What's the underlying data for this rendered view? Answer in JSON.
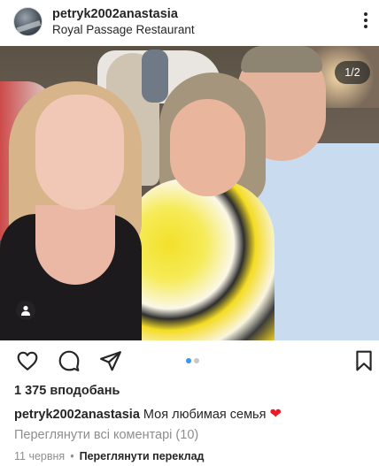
{
  "post": {
    "username": "petryk2002anastasia",
    "location": "Royal Passage Restaurant",
    "carousel_counter": "1/2",
    "likes": "1 375 вподобань",
    "caption_user": "petryk2002anastasia",
    "caption_text": "Моя любимая семья",
    "caption_emoji": "❤",
    "view_comments": "Переглянути всі коментарі (10)",
    "date": "11 червня",
    "separator": "•",
    "translate": "Переглянути переклад"
  },
  "icons": {
    "more": "more-vertical-icon",
    "like": "heart-outline-icon",
    "comment": "comment-bubble-icon",
    "share": "paper-plane-icon",
    "save": "bookmark-icon",
    "tag": "person-tag-icon"
  },
  "colors": {
    "text": "#262626",
    "muted": "#8e8e8e",
    "accent": "#3897f0",
    "heart": "#ed1c24"
  }
}
